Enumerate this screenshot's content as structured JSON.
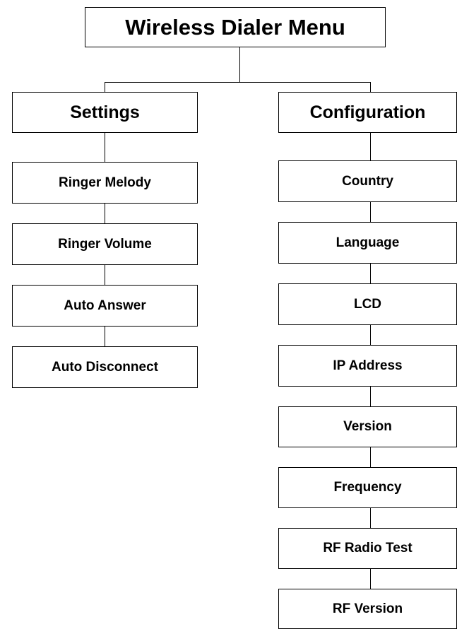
{
  "title": "Wireless Dialer Menu",
  "settings": {
    "label": "Settings",
    "items": [
      "Ringer Melody",
      "Ringer Volume",
      "Auto Answer",
      "Auto Disconnect"
    ]
  },
  "configuration": {
    "label": "Configuration",
    "items": [
      "Country",
      "Language",
      "LCD",
      "IP Address",
      "Version",
      "Frequency",
      "RF Radio Test",
      "RF Version"
    ]
  }
}
